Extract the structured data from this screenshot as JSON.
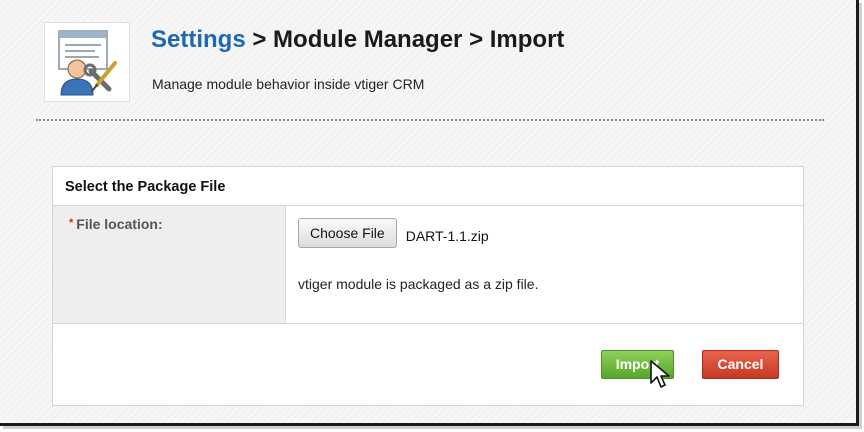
{
  "header": {
    "icon": "module-manager-icon",
    "breadcrumb": {
      "settings": "Settings",
      "separator_1": ">",
      "module_manager": "Module Manager",
      "separator_2": ">",
      "current": "Import"
    },
    "subtitle": "Manage module behavior inside vtiger CRM"
  },
  "panel": {
    "title": "Select the Package File",
    "field": {
      "required_marker": "*",
      "label": "File location:",
      "choose_button": "Choose File",
      "file_name": "DART-1.1.zip",
      "help_text": "vtiger module is packaged as a zip file."
    },
    "buttons": {
      "import": "Import",
      "cancel": "Cancel"
    }
  },
  "colors": {
    "link_blue": "#1e67b3",
    "import_green": "#5cab2f",
    "cancel_red": "#d0412b",
    "required_red": "#d9261c"
  }
}
